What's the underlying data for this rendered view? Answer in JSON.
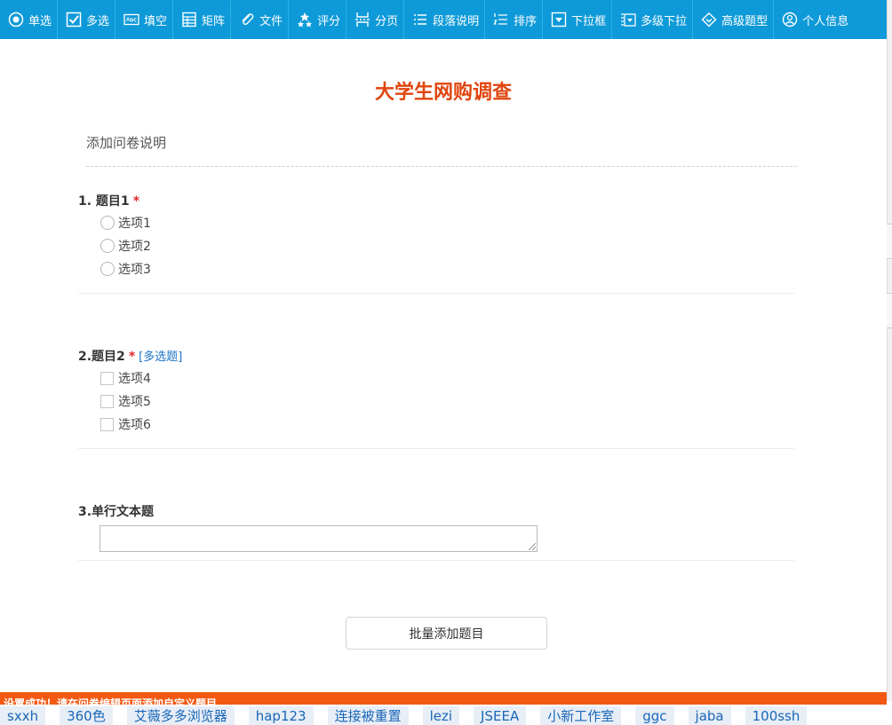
{
  "toolbar": {
    "items": [
      {
        "label": "单选",
        "icon": "radio-icon"
      },
      {
        "label": "多选",
        "icon": "checkbox-icon"
      },
      {
        "label": "填空",
        "icon": "fill-blank-icon"
      },
      {
        "label": "矩阵",
        "icon": "matrix-icon"
      },
      {
        "label": "文件",
        "icon": "paperclip-icon"
      },
      {
        "label": "评分",
        "icon": "rating-icon"
      },
      {
        "label": "分页",
        "icon": "page-break-icon"
      },
      {
        "label": "段落说明",
        "icon": "paragraph-icon"
      },
      {
        "label": "排序",
        "icon": "sort-icon"
      },
      {
        "label": "下拉框",
        "icon": "dropdown-icon"
      },
      {
        "label": "多级下拉",
        "icon": "cascade-dropdown-icon"
      },
      {
        "label": "高级题型",
        "icon": "advanced-icon"
      },
      {
        "label": "个人信息",
        "icon": "user-icon"
      }
    ]
  },
  "survey": {
    "title": "大学生网购调查",
    "description": "添加问卷说明",
    "questions": [
      {
        "title": "1. 题目1",
        "required": "*",
        "type_label": "",
        "options": [
          "选项1",
          "选项2",
          "选项3"
        ]
      },
      {
        "title": "2.题目2",
        "required": "*",
        "type_label": "[多选题]",
        "options": [
          "选项4",
          "选项5",
          "选项6"
        ]
      },
      {
        "title": "3.单行文本题",
        "required": "",
        "type_label": ""
      }
    ],
    "batch_add_label": "批量添加题目"
  },
  "notice": {
    "text": "设置成功！请在问卷编辑页面添加自定义题目"
  },
  "bookmarks": [
    "sxxh",
    "360色",
    "艾薇多多浏览器",
    "hap123",
    "连接被重置",
    "lezi",
    "JSEEA",
    "小新工作室",
    "ggc",
    "jaba",
    "100ssh"
  ],
  "colors": {
    "toolbar_bg": "#0e9ad8",
    "title": "#e0450e",
    "required": "#e3262a",
    "notice_bg": "#f25a13",
    "link": "#1c74c6"
  }
}
